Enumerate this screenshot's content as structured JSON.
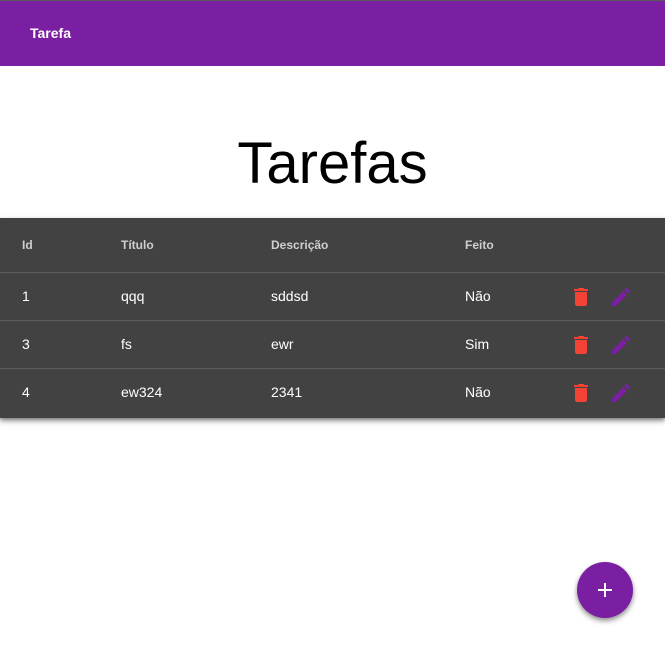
{
  "app_bar": {
    "title": "Tarefa"
  },
  "page": {
    "heading": "Tarefas"
  },
  "table": {
    "headers": {
      "id": "Id",
      "titulo": "Título",
      "descricao": "Descrição",
      "feito": "Feito"
    },
    "rows": [
      {
        "id": "1",
        "titulo": "qqq",
        "descricao": "sddsd",
        "feito": "Não"
      },
      {
        "id": "3",
        "titulo": "fs",
        "descricao": "ewr",
        "feito": "Sim"
      },
      {
        "id": "4",
        "titulo": "ew324",
        "descricao": "2341",
        "feito": "Não"
      }
    ],
    "row_actions": [
      "delete-icon",
      "edit-icon"
    ]
  },
  "fab": {
    "icon": "plus-icon"
  },
  "colors": {
    "primary": "#7b1fa2",
    "table_background": "#424242",
    "delete": "#f44336",
    "edit": "#7b1fa2"
  }
}
